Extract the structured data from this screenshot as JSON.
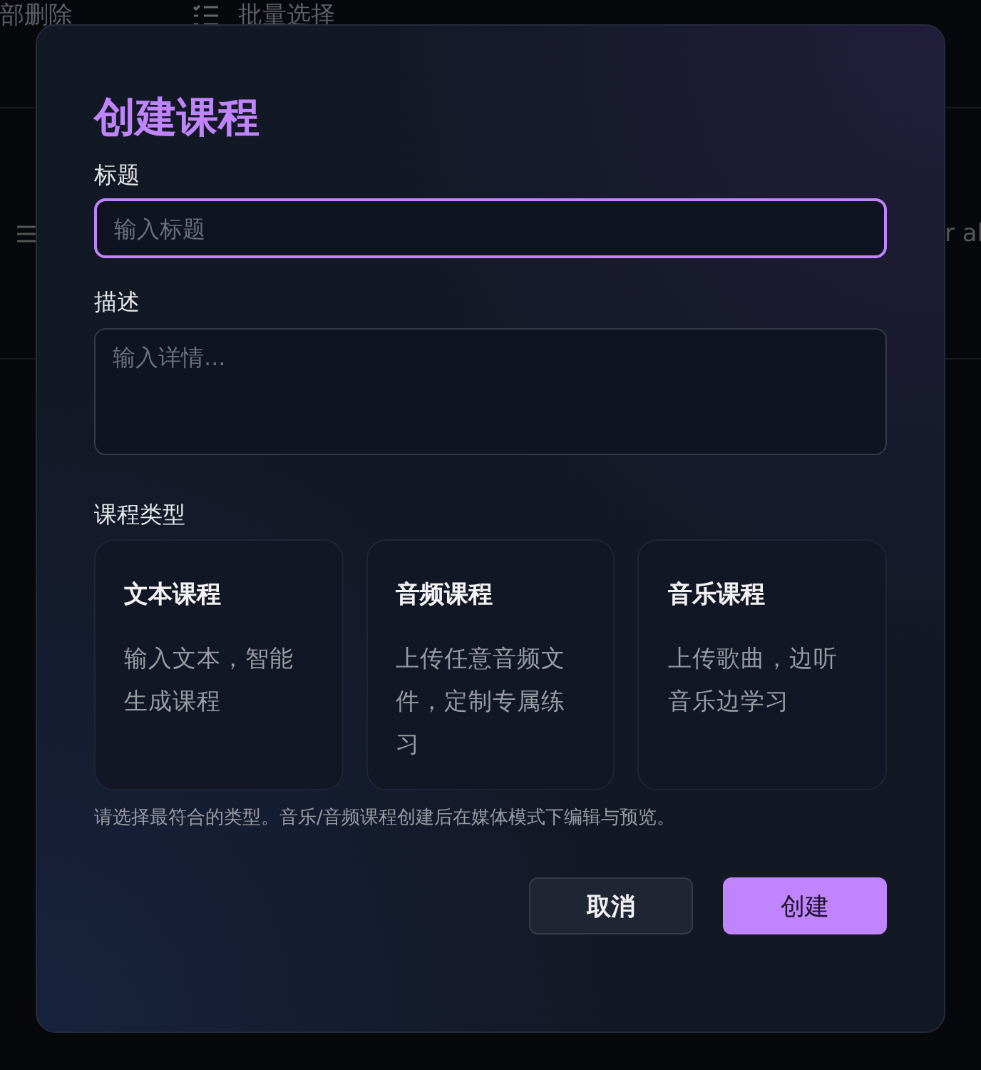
{
  "background": {
    "toolbar": [
      {
        "label": "部删除",
        "kind": "text"
      },
      {
        "label": "批量选择",
        "kind": "list"
      }
    ],
    "row_text": "r al"
  },
  "dialog": {
    "title": "创建课程",
    "fields": [
      {
        "label": "标题",
        "placeholder": "输入标题",
        "kind": "input",
        "focused": true
      },
      {
        "label": "描述",
        "placeholder": "输入详情...",
        "kind": "textarea",
        "focused": false
      }
    ],
    "type_label": "课程类型",
    "types": [
      {
        "title": "文本课程",
        "description": "输入文本，智能生成课程",
        "selected": false
      },
      {
        "title": "音频课程",
        "description": "上传任意音频文件，定制专属练习",
        "selected": false
      },
      {
        "title": "音乐课程",
        "description": "上传歌曲，边听音乐边学习",
        "selected": false
      }
    ],
    "hint": "请选择最符合的类型。音乐/音频课程创建后在媒体模式下编辑与预览。",
    "buttons": [
      {
        "label": "取消",
        "kind": "secondary"
      },
      {
        "label": "创建",
        "kind": "primary"
      }
    ]
  }
}
